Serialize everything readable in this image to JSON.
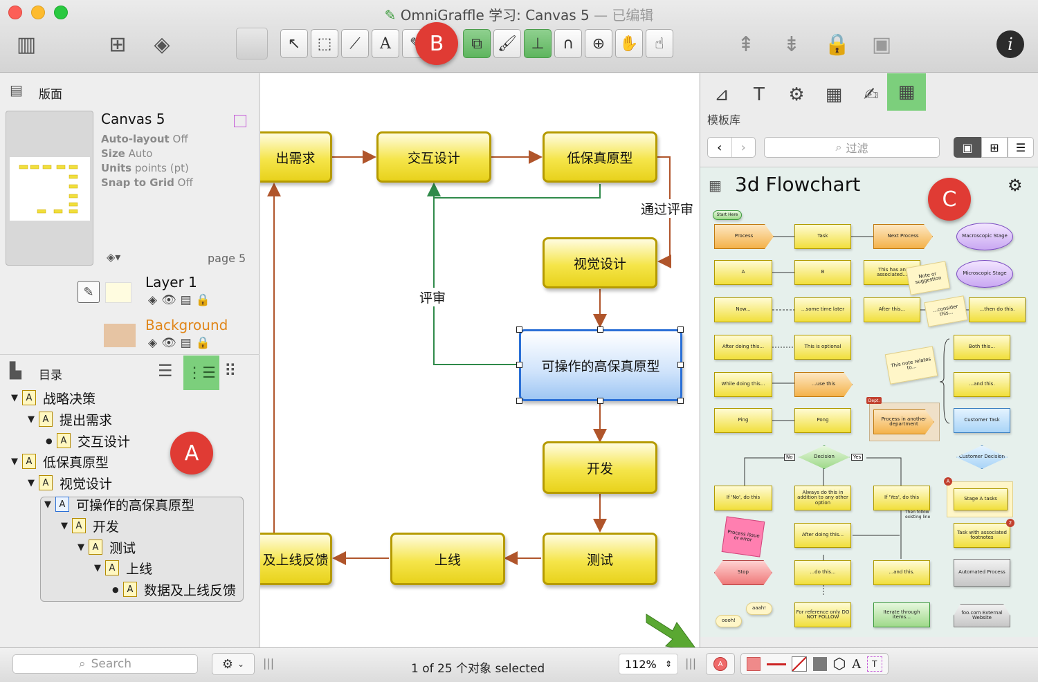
{
  "window": {
    "app": "OmniGraffle",
    "title": "学习: Canvas 5",
    "separator": "—",
    "edited": "已编辑"
  },
  "badges": {
    "a": "A",
    "b": "B",
    "c": "C"
  },
  "toolbar": {
    "left": [
      "sidebar-toggle-icon",
      "new-canvas-icon",
      "layers-add-icon"
    ],
    "tools": [
      "selection-icon",
      "shape-icon",
      "line-icon",
      "text-icon",
      "pen-icon",
      "diagram-icon",
      "style-brush-icon",
      "stamp-icon",
      "magnet-icon",
      "zoom-icon",
      "hand-icon",
      "browse-icon"
    ],
    "right": [
      "bring-front-icon",
      "send-back-icon",
      "lock-icon",
      "group-icon",
      "info-icon"
    ]
  },
  "left": {
    "canvases_title": "版面",
    "canvas": {
      "name": "Canvas 5",
      "autolayout_k": "Auto-layout",
      "autolayout_v": "Off",
      "size_k": "Size",
      "size_v": "Auto",
      "units_k": "Units",
      "units_v": "points (pt)",
      "snap_k": "Snap to Grid",
      "snap_v": "Off",
      "page": "page 5"
    },
    "layers": [
      {
        "name": "Layer 1",
        "color": "#111111"
      },
      {
        "name": "Background",
        "color": "#e0861a"
      }
    ],
    "outline_title": "目录",
    "outline": [
      {
        "label": "战略决策",
        "marker": "▼"
      },
      {
        "label": "提出需求",
        "marker": "▼"
      },
      {
        "label": "交互设计",
        "marker": "●"
      },
      {
        "label": "低保真原型",
        "marker": "▼"
      },
      {
        "label": "视觉设计",
        "marker": "▼"
      },
      {
        "label": "可操作的高保真原型",
        "marker": "▼"
      },
      {
        "label": "开发",
        "marker": "▼"
      },
      {
        "label": "测试",
        "marker": "▼"
      },
      {
        "label": "上线",
        "marker": "▼"
      },
      {
        "label": "数据及上线反馈",
        "marker": "●"
      }
    ]
  },
  "canvas": {
    "nodes": {
      "req": "出需求",
      "ixd": "交互设计",
      "lofi": "低保真原型",
      "visual": "视觉设计",
      "hifi": "可操作的高保真原型",
      "dev": "开发",
      "test": "测试",
      "launch": "上线",
      "feedback": "及上线反馈"
    },
    "labels": {
      "pass_review": "通过评审",
      "review": "评审"
    }
  },
  "right": {
    "library_label": "模板库",
    "filter_placeholder": "过滤",
    "stencil_title": "3d Flowchart",
    "stencil_items": {
      "start": "Start Here",
      "process": "Process",
      "task": "Task",
      "next": "Next Process",
      "macro": "Macroscopic Stage",
      "a": "A",
      "b": "B",
      "assoc": "This has an associated...",
      "note": "Note or suggestion",
      "micro": "Microscopic Stage",
      "now": "Now...",
      "later": "...some time later",
      "after": "After this...",
      "consider": "...consider this...",
      "thendo": "...then do this.",
      "afterdoing": "After doing this...",
      "optional": "This is optional",
      "relates": "This note relates to...",
      "both": "Both this...",
      "while": "While doing this...",
      "usethis": "...use this",
      "andthis": "...and this.",
      "dept": "Dept.",
      "ping": "Ping",
      "pong": "Pong",
      "another": "Process in another department",
      "customer_task": "Customer Task",
      "decision": "Decision",
      "no": "No",
      "yes": "Yes",
      "customer_decision": "Customer Decision",
      "ifno": "If 'No', do this",
      "always": "Always do this in addition to any other option",
      "ifyes": "If 'Yes', do this",
      "stagea": "Stage A tasks",
      "issue": "Process issue or error",
      "afterdoing2": "After doing this...",
      "follow": "Then follow existing line",
      "footnotes": "Task with associated footnotes",
      "stop": "Stop",
      "dothis": "...do this...",
      "andthis2": "...and this.",
      "automated": "Automated Process",
      "aaah": "aaah!",
      "oooh": "oooh!",
      "reference": "For reference only DO NOT FOLLOW",
      "iterate": "Iterate through items...",
      "website": "foo.com External Website"
    }
  },
  "bottom": {
    "search_placeholder": "Search",
    "status": "1 of 25 个对象 selected",
    "zoom": "112%"
  }
}
